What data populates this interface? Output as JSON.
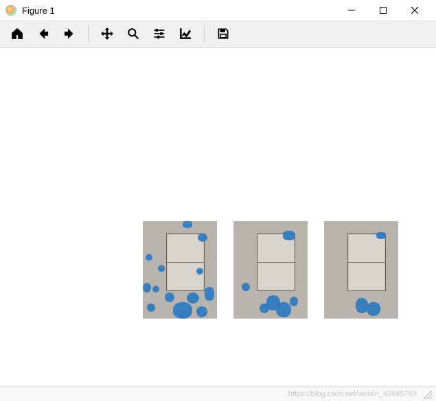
{
  "window": {
    "title": "Figure 1"
  },
  "toolbar": {
    "home": "Home",
    "back": "Back",
    "forward": "Forward",
    "pan": "Pan",
    "zoom": "Zoom",
    "configure": "Configure subplots",
    "edit": "Edit axis",
    "save": "Save"
  },
  "statusbar": {
    "watermark": "https://blog.csdn.net/weixin_42645763"
  },
  "chart_data": [
    {
      "type": "natural-image",
      "subplot": 1,
      "description": "grayscale wall switch photo with dense blue keypoint overlays",
      "keypoint_count_estimate": 14
    },
    {
      "type": "natural-image",
      "subplot": 2,
      "description": "grayscale wall switch photo with moderate blue keypoint overlays",
      "keypoint_count_estimate": 6
    },
    {
      "type": "natural-image",
      "subplot": 3,
      "description": "grayscale wall switch photo with sparse blue keypoint overlays",
      "keypoint_count_estimate": 3
    }
  ]
}
